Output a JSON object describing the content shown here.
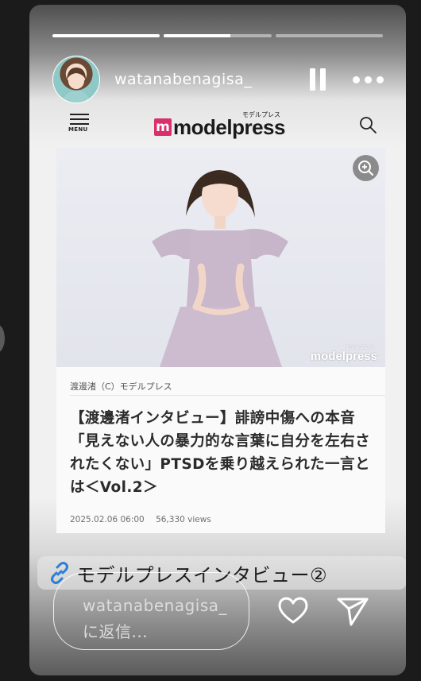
{
  "story": {
    "progress": [
      1.0,
      0.62,
      0.0
    ],
    "username": "watanabenagisa_",
    "icons": {
      "pause": "pause-icon",
      "more": "more-icon",
      "avatar": "avatar"
    }
  },
  "site": {
    "menu_label": "MENU",
    "logo_mark": "m",
    "logo_text": "modelpress",
    "logo_kana": "モデルプレス",
    "brand_color": "#d8306c"
  },
  "article": {
    "watermark": "modelpress",
    "watermark_small": "モデルプレス",
    "caption": "渡邊渚（C）モデルプレス",
    "headline": "【渡邊渚インタビュー】誹謗中傷への本音「見えない人の暴力的な言葉に自分を左右されたくない」PTSDを乗り越えられた一言とは＜Vol.2＞",
    "date": "2025.02.06 06:00",
    "views": "56,330 views"
  },
  "link_sticker": {
    "text": "モデルプレスインタビュー②",
    "icon": "link-icon"
  },
  "reply": {
    "placeholder": "watanabenagisa_に返信..."
  }
}
